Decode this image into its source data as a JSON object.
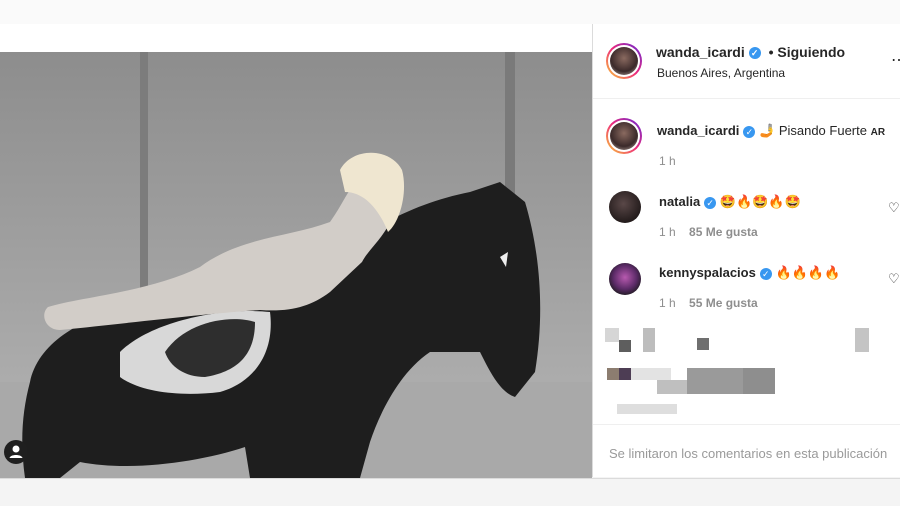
{
  "post": {
    "author": {
      "username": "wanda_icardi",
      "following_label": "• Siguiendo",
      "location": "Buenos Aires, Argentina"
    },
    "caption": {
      "username": "wanda_icardi",
      "text": "Pisando Fuerte",
      "country_code": "AR",
      "time": "1 h"
    },
    "comments": [
      {
        "username": "natalia",
        "text": "🤩🔥🤩🔥🤩",
        "time": "1 h",
        "likes": "85 Me gusta"
      },
      {
        "username": "kennyspalacios",
        "text": "🔥🔥🔥🔥",
        "time": "1 h",
        "likes": "55 Me gusta"
      }
    ],
    "comments_limited": "Se limitaron los comentarios en esta publicación"
  },
  "icons": [
    "verified-icon",
    "heart-icon",
    "user-icon",
    "more-icon"
  ],
  "colors": {
    "verified": "#3897f0",
    "ring_start": "#f9ce34",
    "ring_end": "#6228d7"
  }
}
